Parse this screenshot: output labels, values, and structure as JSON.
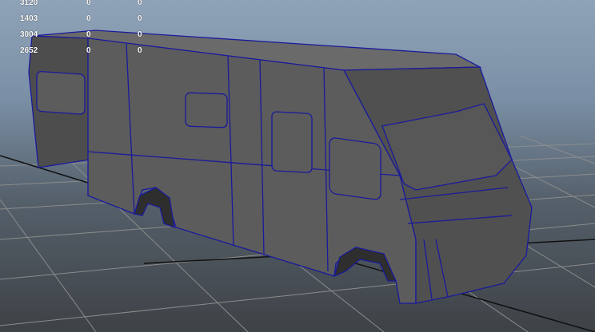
{
  "hud": {
    "rows": [
      {
        "a": "3120",
        "b": "0",
        "c": "0"
      },
      {
        "a": "1403",
        "b": "0",
        "c": "0"
      },
      {
        "a": "3004",
        "b": "0",
        "c": "0"
      },
      {
        "a": "2652",
        "b": "0",
        "c": "0"
      }
    ]
  },
  "colors": {
    "wireframe": "#1a1a9c",
    "mesh_fill": "#5c5c5c",
    "mesh_shade": "#4a4a4a",
    "grid": "#8c8c8c",
    "grid_axis": "#101010"
  }
}
